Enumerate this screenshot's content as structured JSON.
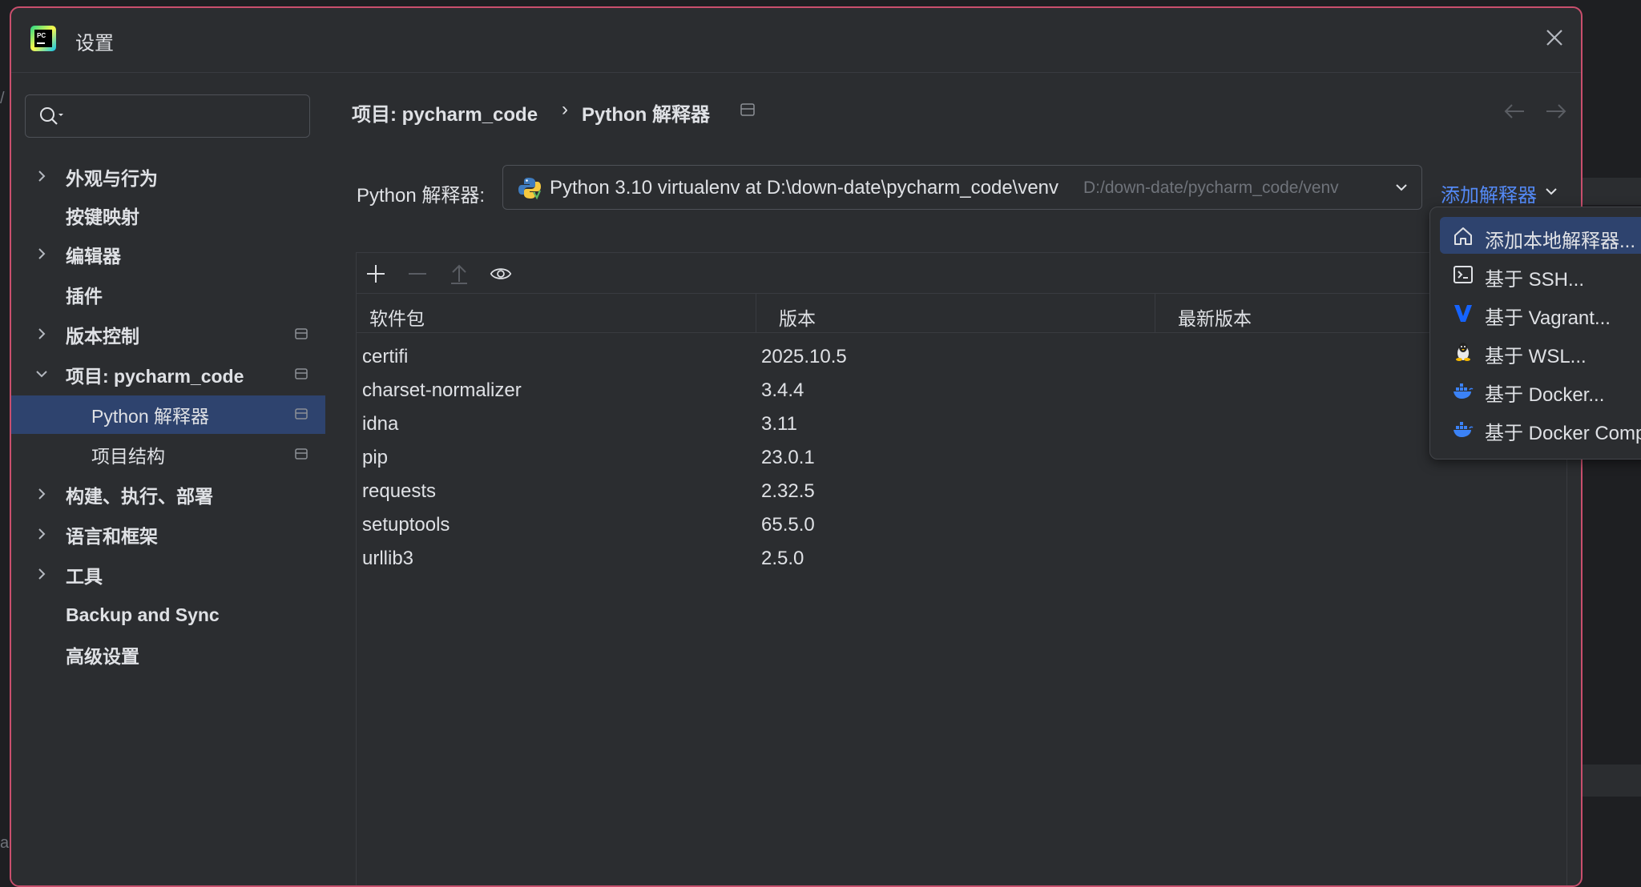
{
  "dialog": {
    "title": "设置"
  },
  "sidebar": {
    "search_placeholder": "",
    "items": [
      {
        "label": "外观与行为"
      },
      {
        "label": "按键映射"
      },
      {
        "label": "编辑器"
      },
      {
        "label": "插件"
      },
      {
        "label": "版本控制"
      },
      {
        "label": "项目: pycharm_code"
      },
      {
        "label": "Python 解释器"
      },
      {
        "label": "项目结构"
      },
      {
        "label": "构建、执行、部署"
      },
      {
        "label": "语言和框架"
      },
      {
        "label": "工具"
      },
      {
        "label": "Backup and Sync"
      },
      {
        "label": "高级设置"
      }
    ]
  },
  "breadcrumb": {
    "project": "项目: pycharm_code",
    "separator": "›",
    "page": "Python 解释器"
  },
  "interpreter": {
    "label": "Python 解释器:",
    "value": "Python 3.10 virtualenv at D:\\down-date\\pycharm_code\\venv",
    "path": "D:/down-date/pycharm_code/venv",
    "add_link": "添加解释器"
  },
  "packages": {
    "columns": [
      "软件包",
      "版本",
      "最新版本"
    ],
    "rows": [
      {
        "name": "certifi",
        "version": "2025.10.5",
        "latest": ""
      },
      {
        "name": "charset-normalizer",
        "version": "3.4.4",
        "latest": ""
      },
      {
        "name": "idna",
        "version": "3.11",
        "latest": ""
      },
      {
        "name": "pip",
        "version": "23.0.1",
        "latest": ""
      },
      {
        "name": "requests",
        "version": "2.32.5",
        "latest": ""
      },
      {
        "name": "setuptools",
        "version": "65.5.0",
        "latest": ""
      },
      {
        "name": "urllib3",
        "version": "2.5.0",
        "latest": ""
      }
    ]
  },
  "popup_menu": {
    "items": [
      {
        "label": "添加本地解释器...",
        "icon": "home-icon"
      },
      {
        "label": "基于 SSH...",
        "icon": "terminal-icon"
      },
      {
        "label": "基于 Vagrant...",
        "icon": "vagrant-icon"
      },
      {
        "label": "基于 WSL...",
        "icon": "linux-penguin-icon"
      },
      {
        "label": "基于 Docker...",
        "icon": "docker-icon"
      },
      {
        "label": "基于 Docker Compose...",
        "icon": "docker-icon"
      }
    ]
  },
  "background": {
    "left_char": "a",
    "slash": "/"
  },
  "colors": {
    "accent": "#548af7",
    "selection": "#2e436e",
    "dialog_border": "#c94f6d",
    "panel": "#2b2d30"
  }
}
